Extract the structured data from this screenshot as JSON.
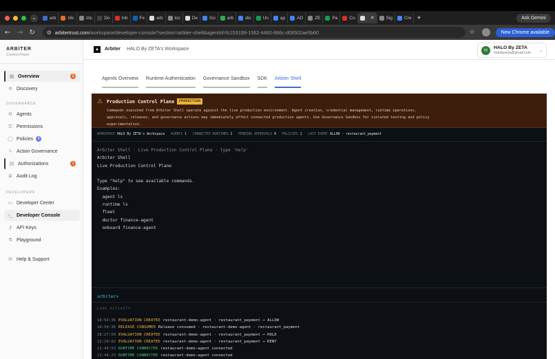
{
  "browser": {
    "tabs": [
      {
        "label": "arb",
        "color": "#3b6fd1"
      },
      {
        "label": "zilc",
        "color": "#e56a2c"
      },
      {
        "label": "zilc",
        "color": "#888888"
      },
      {
        "label": "Do",
        "color": "#444444"
      },
      {
        "label": "Inb",
        "color": "#d93025"
      },
      {
        "label": "Fe",
        "color": "#0a66c2"
      },
      {
        "label": "arb",
        "color": "#dddddd"
      },
      {
        "label": "loc",
        "color": "#888888"
      },
      {
        "label": "De",
        "color": "#dddddd"
      },
      {
        "label": "Go",
        "color": "#4285f4"
      },
      {
        "label": "arb",
        "color": "#34a853"
      },
      {
        "label": "dis",
        "color": "#4285f4"
      },
      {
        "label": "Un",
        "color": "#0f9d58"
      },
      {
        "label": "ap",
        "color": "#4285f4"
      },
      {
        "label": "AD",
        "color": "#4285f4"
      },
      {
        "label": "ZE",
        "color": "#888888"
      },
      {
        "label": "Pa",
        "color": "#0f9d58"
      },
      {
        "label": "Co",
        "color": "#d93025"
      },
      {
        "label": "",
        "color": "#dddddd",
        "active": true
      },
      {
        "label": "Sig",
        "color": "#888888"
      },
      {
        "label": "Cre",
        "color": "#4285f4"
      }
    ],
    "ask_gemini": "Ask Gemini",
    "url_host": "arbitertrust.com",
    "url_path": "/workspace/developer-console?section=arbiter-shell&agentId=fc153199-1562-4460-866c-d08502ae5b60",
    "new_chrome": "New Chrome available"
  },
  "sidebar": {
    "brand": "ARBITER",
    "brand_sub": "Control Plane",
    "items_top": [
      {
        "label": "Overview",
        "icon": "grid-icon",
        "glyph": "▦",
        "badge": "1"
      },
      {
        "label": "Discovery",
        "icon": "radar-icon",
        "glyph": "✲"
      }
    ],
    "governance_title": "GOVERNANCE",
    "governance": [
      {
        "label": "Agents",
        "icon": "bot-icon",
        "glyph": "⚙"
      },
      {
        "label": "Permissions",
        "icon": "key-icon",
        "glyph": "⚿"
      },
      {
        "label": "Policies",
        "icon": "shield-icon",
        "glyph": "◯",
        "badge": "8"
      },
      {
        "label": "Action Governance",
        "icon": "bolt-icon",
        "glyph": "ϟ"
      },
      {
        "label": "Authorizations",
        "icon": "clipboard-icon",
        "glyph": "▤",
        "badge": "1"
      },
      {
        "label": "Audit Log",
        "icon": "log-icon",
        "glyph": "≣"
      }
    ],
    "developers_title": "DEVELOPERS",
    "developers": [
      {
        "label": "Developer Center",
        "icon": "code-box-icon",
        "glyph": "▭"
      },
      {
        "label": "Developer Console",
        "icon": "terminal-icon",
        "glyph": "›_"
      },
      {
        "label": "API Keys",
        "icon": "key-icon",
        "glyph": "⚷"
      },
      {
        "label": "Playground",
        "icon": "flask-icon",
        "glyph": "⚗"
      }
    ],
    "help": {
      "label": "Help & Support",
      "icon": "gear-icon",
      "glyph": "⚙"
    }
  },
  "header": {
    "app_name": "Arbiter",
    "workspace": "HALO By ZETA's Workspace",
    "user_initial": "H",
    "user_name": "HALO By ZETA",
    "user_email": "halobyzeta@gmail.com"
  },
  "tabs": [
    "Agents Overview",
    "Runtime Authentication",
    "Governance Sandbox",
    "SDK",
    "Arbiter Shell"
  ],
  "active_tab": "Arbiter Shell",
  "warning": {
    "title": "Production Control Plane",
    "badge": "PRODUCTION",
    "body": "Commands executed from Arbiter Shell operate against the live production environment. Agent creation, credential management, runtime operations, approvals, releases, and governance actions may immediately affect connected production agents. Use Governance Sandbox for isolated testing and policy experimentation."
  },
  "status": {
    "workspace_label": "WORKSPACE",
    "workspace": "HALO By ZETA's Workspace",
    "agents_label": "AGENTS",
    "agents": "1",
    "runtimes_label": "CONNECTED RUNTIMES",
    "runtimes": "1",
    "approvals_label": "PENDING APPROVALS",
    "approvals": "0",
    "policies_label": "POLICIES",
    "policies": "1",
    "last_event_label": "LAST EVENT",
    "last_event": "ALLOW · restaurant_payment"
  },
  "terminal": {
    "banner": "Arbiter Shell · Live Production Control Plane · type 'help'",
    "lines": [
      "Arbiter Shell",
      "Live Production Control Plane",
      "",
      "Type \"help\" to see available commands.",
      "Examples:",
      "  agent ls",
      "  runtime ls",
      "  fleet",
      "  doctor finance-agent",
      "  onboard finance-agent"
    ],
    "prompt": "arbiter>"
  },
  "activity": {
    "title": "LIVE ACTIVITY",
    "rows": [
      {
        "time": "18:54:36",
        "kind": "EVALUATION CREATED",
        "type": "eval",
        "text": "restaurant-demo-agent · restaurant_payment → ALLOW"
      },
      {
        "time": "18:54:36",
        "kind": "RELEASE CONSUMED",
        "type": "release",
        "text": "Release consumed · restaurant-demo-agent · restaurant_payment"
      },
      {
        "time": "18:27:50",
        "kind": "EVALUATION CREATED",
        "type": "eval",
        "text": "restaurant-demo-agent · restaurant_payment → HOLD"
      },
      {
        "time": "12:29:02",
        "kind": "EVALUATION CREATED",
        "type": "eval",
        "text": "restaurant-demo-agent · restaurant_payment → DENY"
      },
      {
        "time": "21:44:53",
        "kind": "RUNTIME CONNECTED",
        "type": "runtime",
        "text": "restaurant-demo-agent connected"
      },
      {
        "time": "21:44:23",
        "kind": "RUNTIME CONNECTED",
        "type": "runtime",
        "text": "restaurant-demo-agent connected"
      }
    ]
  }
}
